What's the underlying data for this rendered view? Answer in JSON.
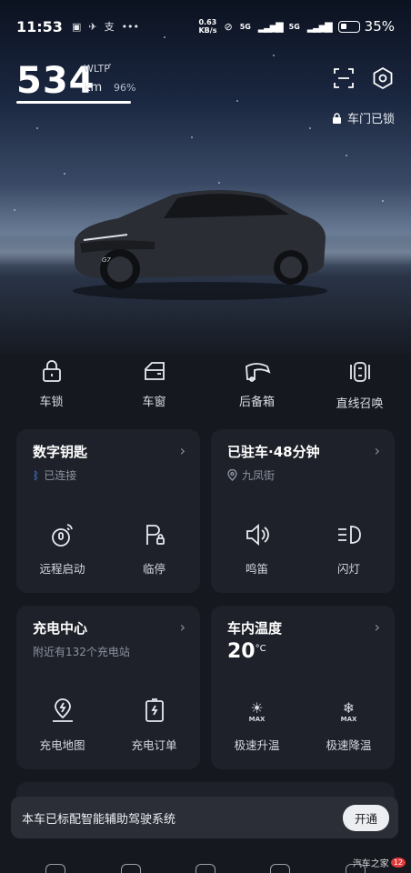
{
  "status_bar": {
    "time": "11:53",
    "net_speed_value": "0.63",
    "net_speed_unit": "KB/s",
    "network_a": "5G",
    "network_b": "5G",
    "battery": "35%"
  },
  "range": {
    "value": "534",
    "standard": "WLTP",
    "unit": "km",
    "battery_percent": "96%"
  },
  "lock_status": "车门已锁",
  "quick_actions": [
    {
      "label": "车锁",
      "icon": "lock-icon"
    },
    {
      "label": "车窗",
      "icon": "window-icon"
    },
    {
      "label": "后备箱",
      "icon": "trunk-icon"
    },
    {
      "label": "直线召唤",
      "icon": "summon-icon"
    }
  ],
  "cards": {
    "digital_key": {
      "title": "数字钥匙",
      "subtitle": "已连接",
      "actions": [
        "远程启动",
        "临停"
      ]
    },
    "parking": {
      "title": "已驻车·48分钟",
      "subtitle": "九凤街",
      "actions": [
        "鸣笛",
        "闪灯"
      ]
    },
    "charging": {
      "title": "充电中心",
      "subtitle": "附近有132个充电站",
      "actions": [
        "充电地图",
        "充电订单"
      ]
    },
    "climate": {
      "title": "车内温度",
      "temp_value": "20",
      "temp_unit": "°C",
      "max_label": "MAX",
      "actions": [
        "极速升温",
        "极速降温"
      ]
    }
  },
  "banner": {
    "text": "本车已标配智能辅助驾驶系统",
    "button": "开通"
  },
  "car_badge": "G7",
  "watermark": {
    "text": "汽车之家",
    "badge": "12"
  }
}
